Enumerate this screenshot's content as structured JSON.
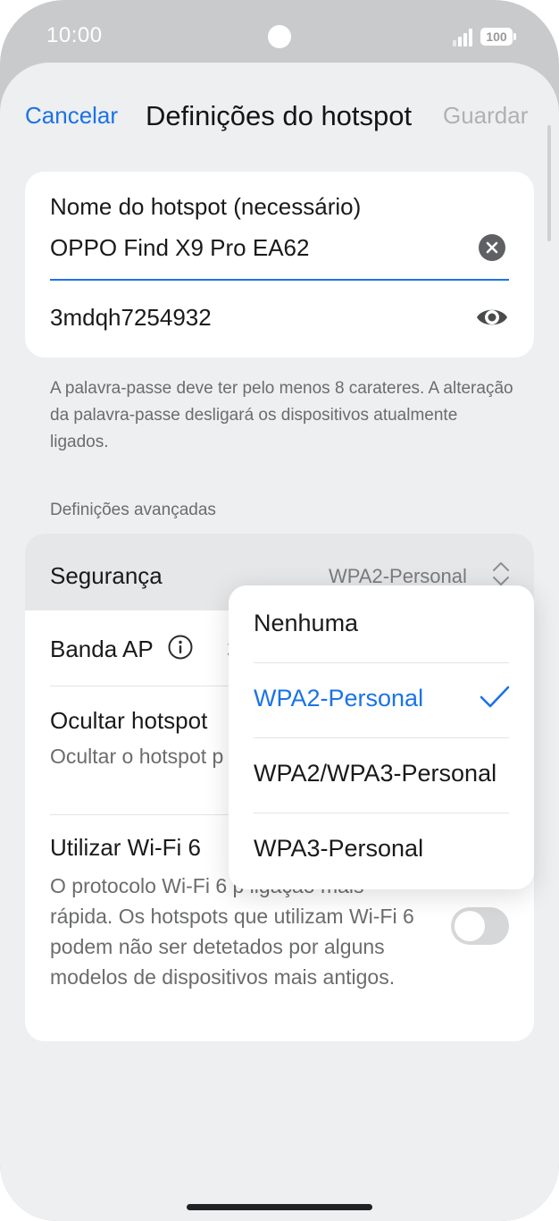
{
  "status_bar": {
    "time": "10:00",
    "battery": "100",
    "camera_icon": "camera-dot",
    "signal_icon": "cellular-signal"
  },
  "header": {
    "cancel_label": "Cancelar",
    "title": "Definições do hotspot",
    "save_label": "Guardar"
  },
  "hotspot": {
    "name_label": "Nome do hotspot (necessário)",
    "name_value": "OPPO Find X9 Pro EA62",
    "password_value": "3mdqh7254932",
    "password_hint": "A palavra-passe deve ter pelo menos 8 carateres. A alteração da palavra-passe desligará os dispositivos atualmente ligados."
  },
  "advanced": {
    "section_title": "Definições avançadas",
    "security_label": "Segurança",
    "security_value": "WPA2-Personal",
    "band_label": "Banda AP",
    "band_value_visible": "2",
    "hide_label": "Ocultar hotspot",
    "hide_desc": "Ocultar o hotspot p ser ligado manualm",
    "wifi6_label": "Utilizar Wi-Fi 6",
    "wifi6_desc": "O protocolo Wi-Fi 6 p ligação mais rápida. Os hotspots que utilizam Wi-Fi 6 podem não ser detetados por alguns modelos de dispositivos mais antigos.",
    "wifi6_enabled": false
  },
  "security_menu": {
    "options": [
      "Nenhuma",
      "WPA2-Personal",
      "WPA2/WPA3-Personal",
      "WPA3-Personal"
    ],
    "selected_index": 1
  },
  "colors": {
    "accent": "#1a73e8",
    "screen_bg": "#eeeff1",
    "frame": "#c9cacc"
  }
}
